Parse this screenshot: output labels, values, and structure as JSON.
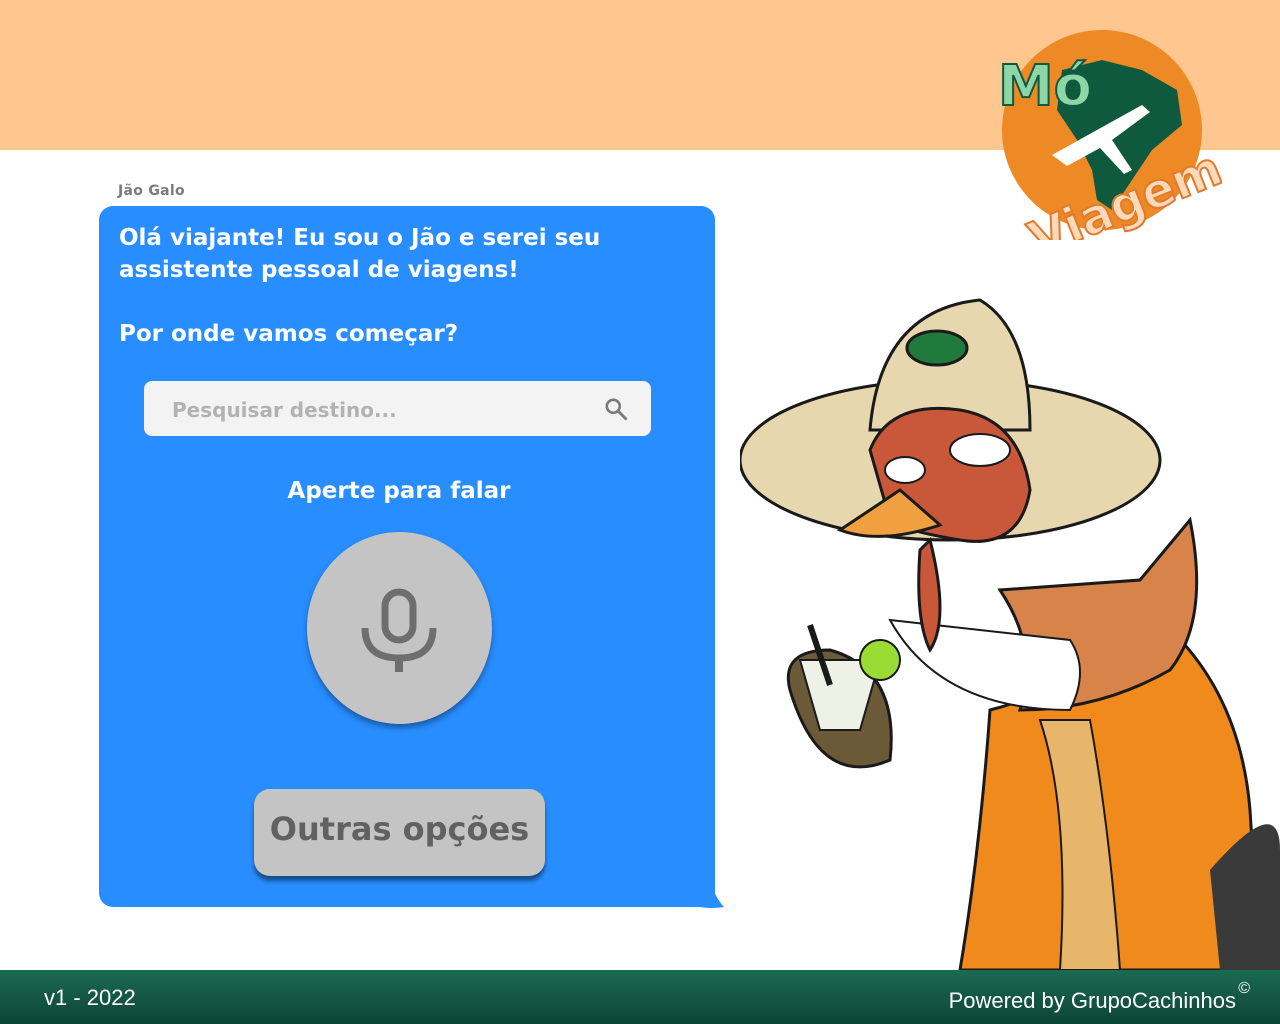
{
  "header": {
    "logo": {
      "line1": "Mó",
      "line2": "Viagem"
    }
  },
  "chat": {
    "sender": "Jão Galo",
    "message_lines": [
      "Olá viajante! Eu sou o Jão e serei seu assistente pessoal de viagens!",
      "Por onde vamos começar?"
    ],
    "search": {
      "placeholder": "Pesquisar destino...",
      "value": "",
      "icon": "search-icon"
    },
    "speak_label": "Aperte para falar",
    "mic_icon": "microphone-icon",
    "other_options_label": "Outras opções"
  },
  "footer": {
    "version": "v1 - 2022",
    "powered_by": "Powered by GrupoCachinhos",
    "copyright_symbol": "©"
  },
  "colors": {
    "banner": "#ffc68f",
    "bubble": "#288dff",
    "button_gray": "#c4c4c4",
    "footer": "#1c6a52"
  }
}
